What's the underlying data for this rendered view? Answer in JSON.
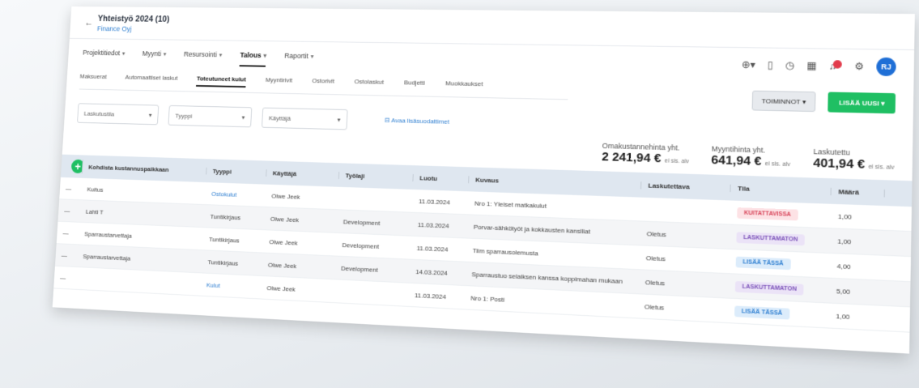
{
  "header": {
    "back_glyph": "←",
    "title": "Yhteistyö 2024 (10)",
    "subtitle": "Finance Oyj"
  },
  "nav": [
    {
      "label": "Projektitiedot",
      "dropdown": true
    },
    {
      "label": "Myynti",
      "dropdown": true
    },
    {
      "label": "Resursointi",
      "dropdown": true
    },
    {
      "label": "Talous",
      "dropdown": true,
      "active": true
    },
    {
      "label": "Raportit",
      "dropdown": true
    }
  ],
  "toolbar_icons": [
    "help-icon",
    "document-icon",
    "timer-icon",
    "calendar-icon",
    "notifications-icon",
    "settings-icon"
  ],
  "avatar_initials": "RJ",
  "subtabs": [
    {
      "label": "Maksuerat"
    },
    {
      "label": "Automaattiset laskut"
    },
    {
      "label": "Toteutuneet kulut",
      "active": true
    },
    {
      "label": "Myyntirivit"
    },
    {
      "label": "Ostorivit"
    },
    {
      "label": "Ostolaskut"
    },
    {
      "label": "Budjetti"
    },
    {
      "label": "Muokkaukset"
    }
  ],
  "actions": {
    "toiminnot": "TOIMINNOT",
    "add": "LISÄÄ UUSI"
  },
  "filters": [
    {
      "placeholder": "Laskutustila"
    },
    {
      "placeholder": "Tyyppi"
    },
    {
      "placeholder": "Käyttäjä"
    }
  ],
  "quick_filter_link": "Avaa lisäsuodattimet",
  "totals": [
    {
      "label": "Omakustannehinta yht.",
      "value": "2 241,94 €",
      "unit": "ei sis. alv"
    },
    {
      "label": "Myyntihinta yht.",
      "value": "641,94 €",
      "unit": "ei sis. alv"
    },
    {
      "label": "Laskutettu",
      "value": "401,94 €",
      "unit": "ei sis. alv"
    }
  ],
  "table": {
    "columns": [
      "Kohdista kustannuspaikkaan",
      "Tyyppi",
      "Käyttäjä",
      "Työlaji",
      "Luotu",
      "Kuvaus",
      "Laskutettava",
      "Tila",
      "Määrä"
    ],
    "rows": [
      {
        "kohdista": "Kuitus",
        "tyyppi": "Ostokulut",
        "tyyppi_link": true,
        "kayttaja": "Olwe Jeek",
        "tyolaji": "",
        "luotu": "11.03.2024",
        "kuvaus": "Nro 1: Yleiset matkakulut",
        "laskutettava": "",
        "tila": "KUITATTAVISSA",
        "tila_color": "red",
        "maara": "1,00"
      },
      {
        "kohdista": "Lahti T",
        "tyyppi": "Tuntikirjaus",
        "tyyppi_link": false,
        "kayttaja": "Olwe Jeek",
        "tyolaji": "Development",
        "luotu": "11.03.2024",
        "kuvaus": "Porvar-sähkötyöt ja kokkausten kanslliat",
        "laskutettava": "Oletus",
        "tila": "LASKUTTAMATON",
        "tila_color": "purple",
        "maara": "1,00"
      },
      {
        "kohdista": "Sparraustarvettaja",
        "tyyppi": "Tuntikirjaus",
        "tyyppi_link": false,
        "kayttaja": "Olwe Jeek",
        "tyolaji": "Development",
        "luotu": "11.03.2024",
        "kuvaus": "Tiim sparrausolemusta",
        "laskutettava": "Oletus",
        "tila": "LISÄÄ TÄSSÄ",
        "tila_color": "blue",
        "maara": "4,00"
      },
      {
        "kohdista": "Sparraustarvettaja",
        "tyyppi": "Tuntikirjaus",
        "tyyppi_link": false,
        "kayttaja": "Olwe Jeek",
        "tyolaji": "Development",
        "luotu": "14.03.2024",
        "kuvaus": "Sparraustuo selaiksen kanssa koppimahan mukaan",
        "laskutettava": "Oletus",
        "tila": "LASKUTTAMATON",
        "tila_color": "purple",
        "maara": "5,00"
      },
      {
        "kohdista": "",
        "tyyppi": "Kulut",
        "tyyppi_link": true,
        "kayttaja": "Olwe Jeek",
        "tyolaji": "",
        "luotu": "11.03.2024",
        "kuvaus": "Nro 1: Posti",
        "laskutettava": "Oletus",
        "tila": "LISÄÄ TÄSSÄ",
        "tila_color": "blue",
        "maara": "1,00"
      }
    ]
  },
  "colors": {
    "accent_green": "#1fbf63",
    "link_blue": "#2f7fd1",
    "header_bg": "#dfe7f0"
  }
}
